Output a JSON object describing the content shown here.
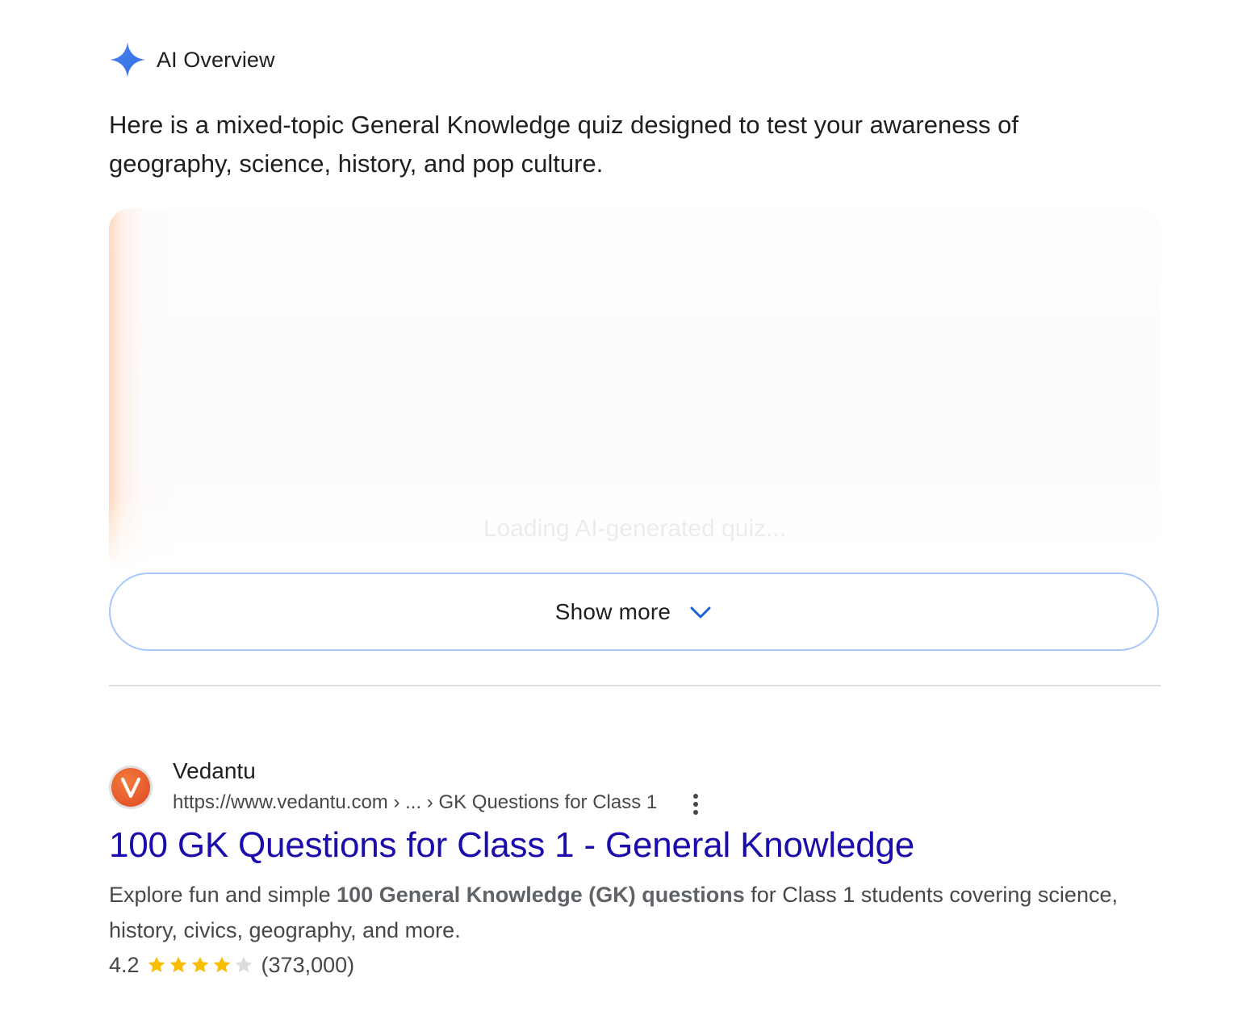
{
  "ai_overview": {
    "title": "AI Overview",
    "icon": "sparkle-icon",
    "intro": "Here is a mixed-topic General Knowledge quiz designed to test your awareness of geography, science, history, and pop culture.",
    "quiz_loading_text": "Loading AI-generated quiz...",
    "show_more_label": "Show more",
    "accent_color": "#4285f4"
  },
  "result": {
    "favicon_letter": "V",
    "site_name": "Vedantu",
    "url": "https://www.vedantu.com › ... › GK Questions for Class 1",
    "title": "100 GK Questions for Class 1 - General Knowledge",
    "snippet_parts": [
      {
        "text": "Explore fun and simple ",
        "bold": false
      },
      {
        "text": "100 General Knowledge (GK) questions",
        "bold": true
      },
      {
        "text": " for Class 1 students covering science, history, civics, geography, and more.",
        "bold": false
      }
    ],
    "rating": "4.2",
    "rating_fraction": 0.84,
    "stars_filled": 4,
    "stars_total": 5,
    "review_count": "(373,000)",
    "star_color": "#fbbc04",
    "title_color": "#1a0dab"
  }
}
